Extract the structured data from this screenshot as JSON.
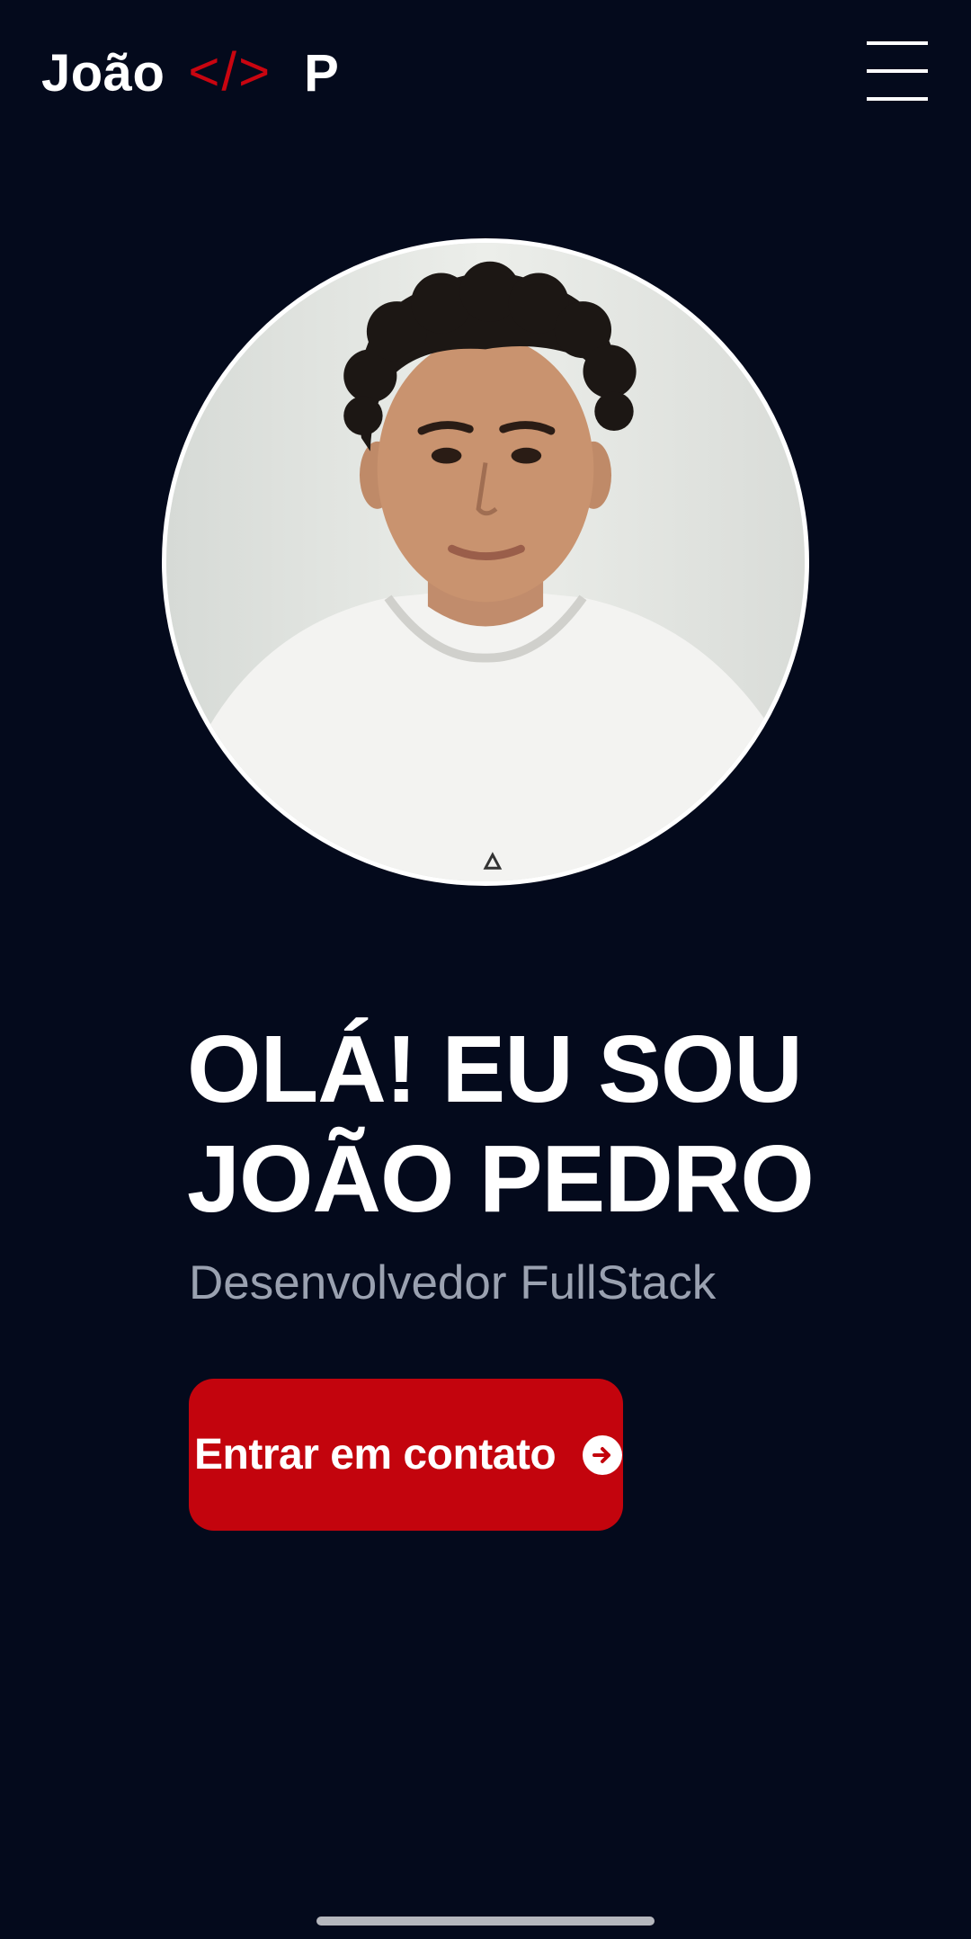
{
  "header": {
    "logo_first": "João",
    "logo_code": "</>",
    "logo_last": "P",
    "menu_icon": "hamburger-menu-icon"
  },
  "avatar": {
    "description_icon": "profile-photo"
  },
  "hero": {
    "title_line1": "OLÁ! EU SOU",
    "title_line2": "JOÃO PEDRO",
    "subtitle": "Desenvolvedor FullStack"
  },
  "cta": {
    "label": "Entrar em contato",
    "icon": "arrow-right-circle-icon"
  },
  "colors": {
    "background": "#040a1c",
    "accent": "#c3040d",
    "text": "#ffffff",
    "muted": "#9aa1b0"
  }
}
